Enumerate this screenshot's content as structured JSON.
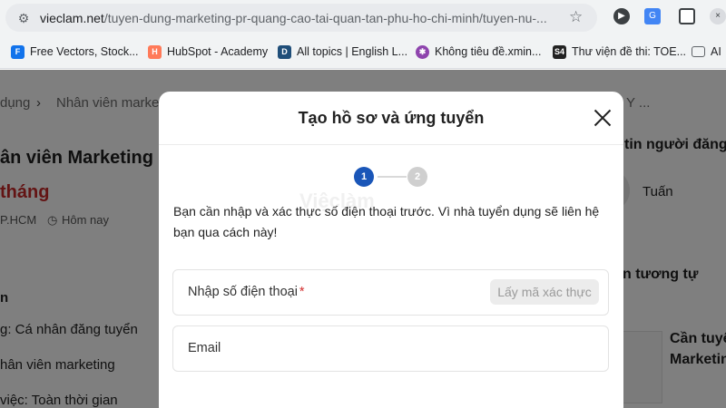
{
  "browser": {
    "url_domain": "vieclam.net",
    "url_path": "/tuyen-dung-marketing-pr-quang-cao-tai-quan-tan-phu-ho-chi-minh/tuyen-nu-...",
    "site_info_icon": "tune-icon",
    "bookmarks": [
      {
        "label": "Free Vectors, Stock...",
        "icon": "freepik-icon",
        "color": "#1273eb"
      },
      {
        "label": "HubSpot - Academy",
        "icon": "hubspot-icon",
        "color": "#ff7a59"
      },
      {
        "label": "All topics | English L...",
        "icon": "d-logo-icon",
        "color": "#1f4e79"
      },
      {
        "label": "Không tiêu đề.xmin...",
        "icon": "xmind-icon",
        "color": "#8e44ad"
      },
      {
        "label": "Thư viện đề thi: TOE...",
        "icon": "s4-icon",
        "color": "#222222"
      },
      {
        "label": "AI",
        "icon": "folder-icon",
        "color": "#5f6368"
      }
    ]
  },
  "background": {
    "breadcrumb_1": "dụng",
    "breadcrumb_2": "Nhân viên marketin",
    "breadcrumb_3": "Y ...",
    "job_title": "ân viên Marketing -",
    "salary": "tháng",
    "location": "P.HCM",
    "posted": "Hôm nay",
    "section_heading": "n",
    "detail_1": "g: Cá nhân đăng tuyển",
    "detail_2": "hân viên marketing",
    "detail_3": "việc: Toàn thời gian",
    "poster_heading": "tin người đăng",
    "poster_name": "Tuấn",
    "similar_heading": "n tương tự",
    "similar_job": "Cần tuyể",
    "similar_job_2": "Marketin"
  },
  "modal": {
    "title": "Tạo hồ sơ và ứng tuyển",
    "step_1": "1",
    "step_2": "2",
    "watermark": "Việclàm",
    "message": "Bạn cần nhập và xác thực số điện thoại trước. Vì nhà tuyển dụng sẽ liên hệ bạn qua cách này!",
    "phone_label": "Nhập số điện thoại",
    "required_mark": "*",
    "otp_button": "Lấy mã xác thực",
    "email_label": "Email",
    "colors": {
      "step_active": "#1a56b8",
      "step_inactive": "#cfcfcf",
      "required": "#d32f2f"
    }
  }
}
